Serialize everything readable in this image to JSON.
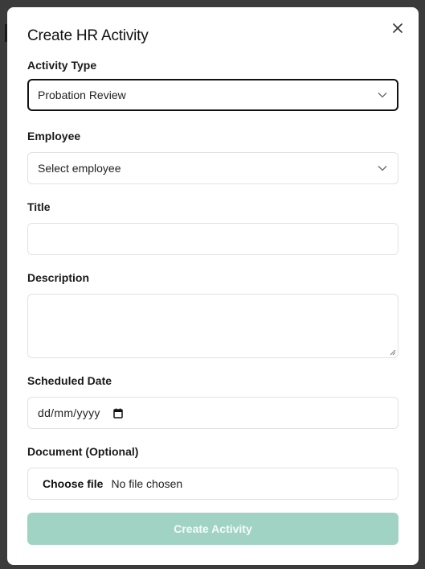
{
  "dialog": {
    "title": "Create HR Activity",
    "close_icon": "close-icon"
  },
  "fields": {
    "activity_type": {
      "label": "Activity Type",
      "value": "Probation Review"
    },
    "employee": {
      "label": "Employee",
      "placeholder": "Select employee"
    },
    "title": {
      "label": "Title",
      "value": ""
    },
    "description": {
      "label": "Description",
      "value": ""
    },
    "scheduled_date": {
      "label": "Scheduled Date",
      "placeholder": "dd/mm/yyyy",
      "icon": "calendar-icon"
    },
    "document": {
      "label": "Document (Optional)",
      "button_label": "Choose file",
      "status": "No file chosen"
    }
  },
  "actions": {
    "submit_label": "Create Activity"
  },
  "colors": {
    "submit_bg": "#a1d3c5",
    "focus_border": "#111111",
    "input_border": "#e2e2e2"
  }
}
